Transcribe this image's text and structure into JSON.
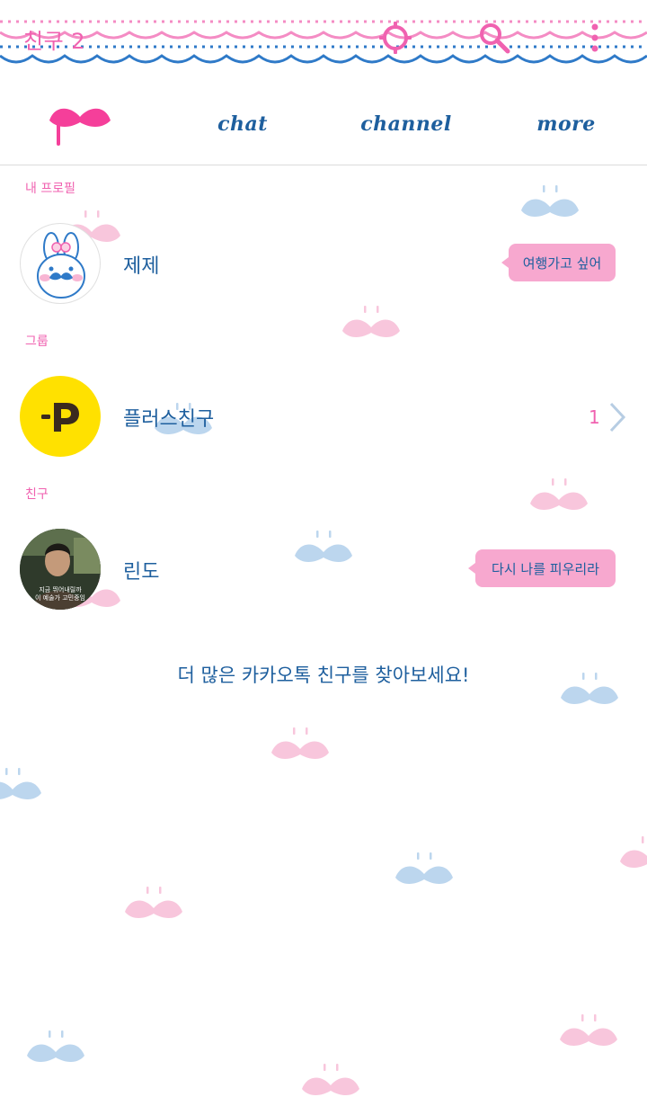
{
  "header": {
    "title": "친구 2",
    "icons": [
      "settings-gear-icon",
      "search-icon",
      "more-vertical-icon"
    ],
    "colors": {
      "pink": "#f062b0",
      "blue": "#2f7ac8"
    }
  },
  "tabs": [
    {
      "name": "friends",
      "icon": "mustache-icon",
      "label": ""
    },
    {
      "name": "chat",
      "label": "chat"
    },
    {
      "name": "channel",
      "label": "channel"
    },
    {
      "name": "more",
      "label": "more"
    }
  ],
  "sections": {
    "my_profile": "내 프로필",
    "group": "그룹",
    "friends": "친구"
  },
  "profile": {
    "name": "제제",
    "status": "여행가고 싶어",
    "avatar_icon": "bunny-mustache-avatar"
  },
  "group": {
    "name": "플러스친구",
    "count": "1",
    "avatar_icon": "plus-friend-logo"
  },
  "friend": {
    "name": "린도",
    "status": "다시 나를 피우리라",
    "avatar_caption_line1": "지금 뛰어내릴까",
    "avatar_caption_line2": "이 예술가 고민중임",
    "avatar_icon": "photo-avatar"
  },
  "find_more": "더 많은 카카오톡 친구를 찾아보세요!"
}
